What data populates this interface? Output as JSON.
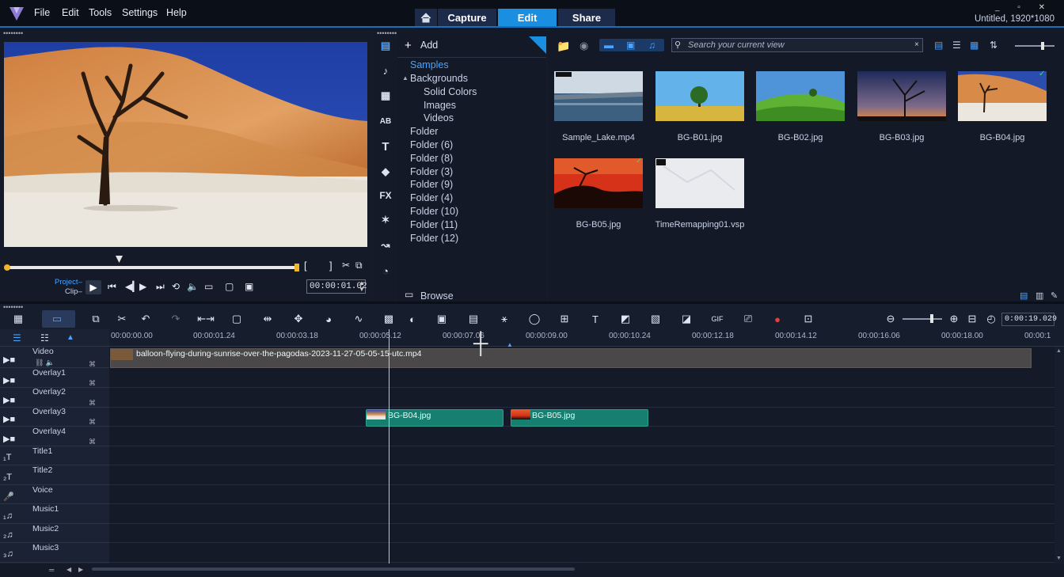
{
  "app": {
    "menu": [
      "File",
      "Edit",
      "Tools",
      "Settings",
      "Help"
    ],
    "workspace_tabs": {
      "capture": "Capture",
      "edit": "Edit",
      "share": "Share"
    },
    "project_title": "Untitled, 1920*1080",
    "window_controls": "_ ▫ ✕",
    "accent_color": "#1a8ee0"
  },
  "player": {
    "mode_project": "Project–",
    "mode_clip": "Clip–",
    "timecode": "00:00:01.02",
    "mark_in": "[",
    "mark_out": "]"
  },
  "library": {
    "add_label": "Add",
    "browse_label": "Browse",
    "fx_label": "FX",
    "tree": [
      "Samples",
      "Backgrounds",
      "Solid Colors",
      "Images",
      "Videos",
      "Folder",
      "Folder (6)",
      "Folder (8)",
      "Folder (3)",
      "Folder (9)",
      "Folder (4)",
      "Folder (10)",
      "Folder (11)",
      "Folder (12)"
    ],
    "search_placeholder": "Search your current view",
    "items": [
      {
        "name": "Sample_Lake.mp4",
        "kind": "video"
      },
      {
        "name": "BG-B01.jpg",
        "kind": "image"
      },
      {
        "name": "BG-B02.jpg",
        "kind": "image"
      },
      {
        "name": "BG-B03.jpg",
        "kind": "image"
      },
      {
        "name": "BG-B04.jpg",
        "kind": "image",
        "used": true
      },
      {
        "name": "BG-B05.jpg",
        "kind": "image",
        "used": true
      },
      {
        "name": "TimeRemapping01.vsp",
        "kind": "project"
      }
    ]
  },
  "timeline": {
    "zoom_timecode": "0:00:19.029",
    "ruler": [
      "00:00:00.00",
      "00:00:01.24",
      "00:00:03.18",
      "00:00:05.12",
      "00:00:07.06",
      "00:00:09.00",
      "00:00:10.24",
      "00:00:12.18",
      "00:00:14.12",
      "00:00:16.06",
      "00:00:18.00",
      "00:00:1"
    ],
    "tracks": [
      "Video",
      "Overlay1",
      "Overlay2",
      "Overlay3",
      "Overlay4",
      "Title1",
      "Title2",
      "Voice",
      "Music1",
      "Music2",
      "Music3"
    ],
    "video_clip": "balloon-flying-during-sunrise-over-the-pagodas-2023-11-27-05-05-15-utc.mp4",
    "overlay3_clips": [
      "BG-B04.jpg",
      "BG-B05.jpg"
    ]
  }
}
